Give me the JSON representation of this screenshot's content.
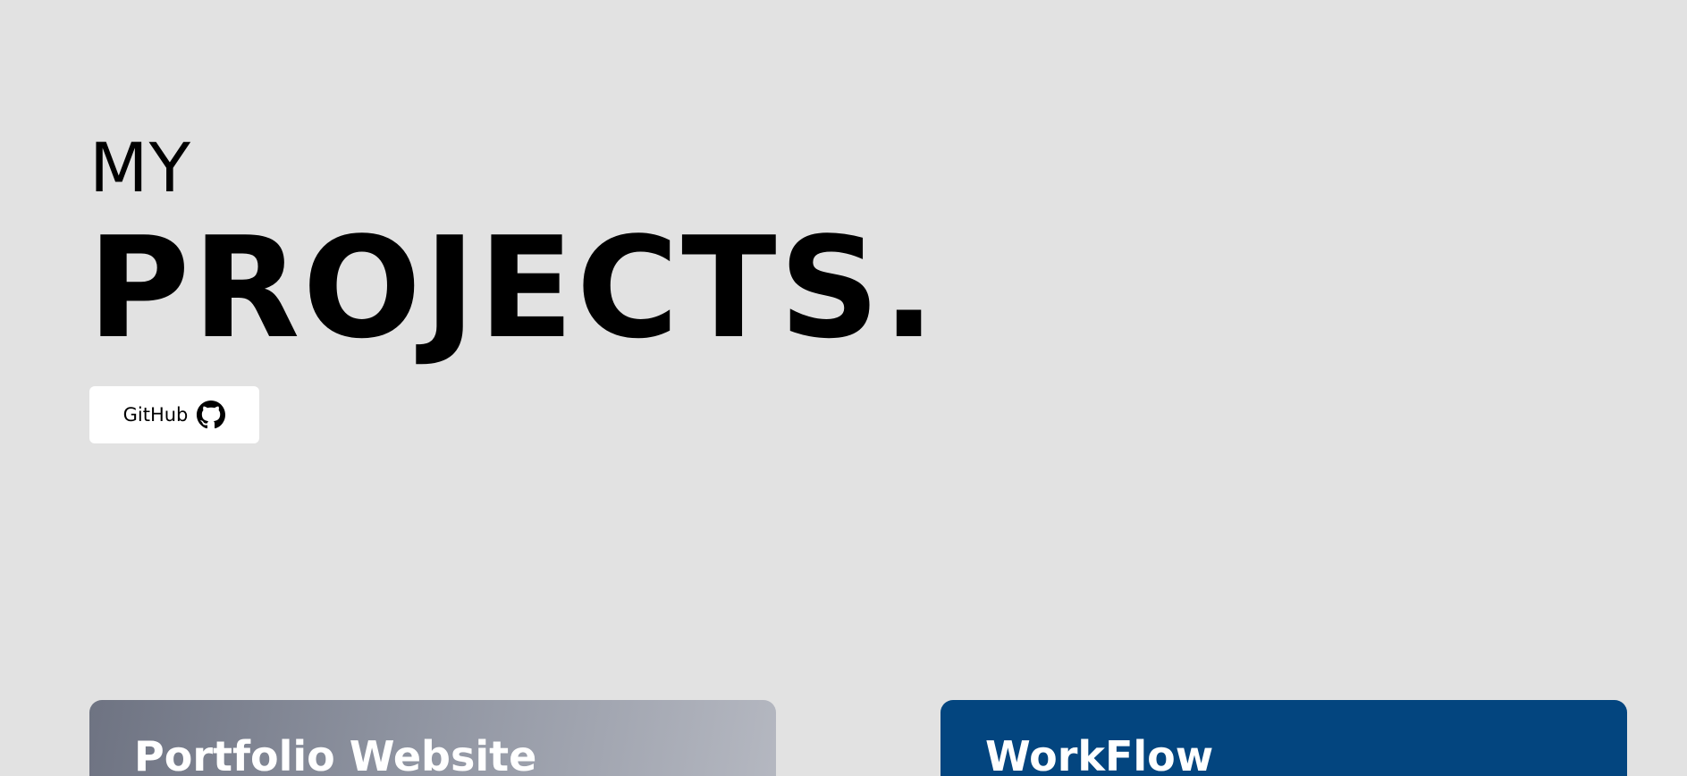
{
  "hero": {
    "title_small": "MY",
    "title_large": "PROJECTS."
  },
  "github_button": {
    "label": "GitHub",
    "icon": "github-icon"
  },
  "projects": [
    {
      "title": "Portfolio Website"
    },
    {
      "title": "WorkFlow"
    }
  ],
  "colors": {
    "background": "#e2e2e2",
    "button_bg": "#ffffff",
    "workflow_card": "#03457f",
    "portfolio_card_start": "#6e7382",
    "portfolio_card_end": "#b5b8c1"
  }
}
